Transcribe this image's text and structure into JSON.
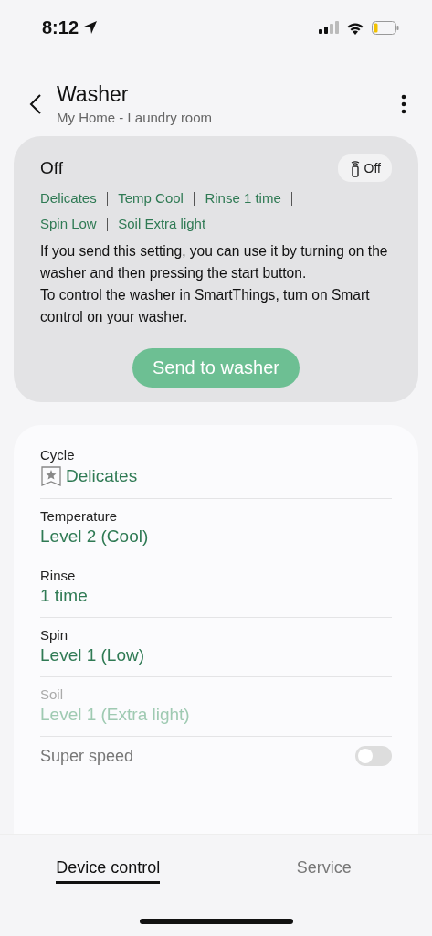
{
  "status_bar": {
    "time": "8:12"
  },
  "header": {
    "title": "Washer",
    "subtitle": "My Home - Laundry room"
  },
  "status_card": {
    "state": "Off",
    "remote_badge": "Off",
    "summary": [
      "Delicates",
      "Temp Cool",
      "Rinse 1 time",
      "Spin Low",
      "Soil Extra light"
    ],
    "message": "If you send this setting, you can use it by turning on the washer and then pressing the start button.\nTo control the washer in SmartThings, turn on Smart control on your washer.",
    "button": "Send to washer"
  },
  "settings": [
    {
      "kind": "cycle",
      "label": "Cycle",
      "value": "Delicates",
      "disabled": false
    },
    {
      "kind": "option",
      "label": "Temperature",
      "value": "Level 2 (Cool)",
      "disabled": false
    },
    {
      "kind": "option",
      "label": "Rinse",
      "value": "1 time",
      "disabled": false
    },
    {
      "kind": "option",
      "label": "Spin",
      "value": "Level 1 (Low)",
      "disabled": false
    },
    {
      "kind": "option",
      "label": "Soil",
      "value": "Level 1 (Extra light)",
      "disabled": true
    },
    {
      "kind": "toggle",
      "label": "Super speed",
      "on": false
    }
  ],
  "tabs": [
    {
      "label": "Device control",
      "selected": true
    },
    {
      "label": "Service",
      "selected": false
    }
  ]
}
